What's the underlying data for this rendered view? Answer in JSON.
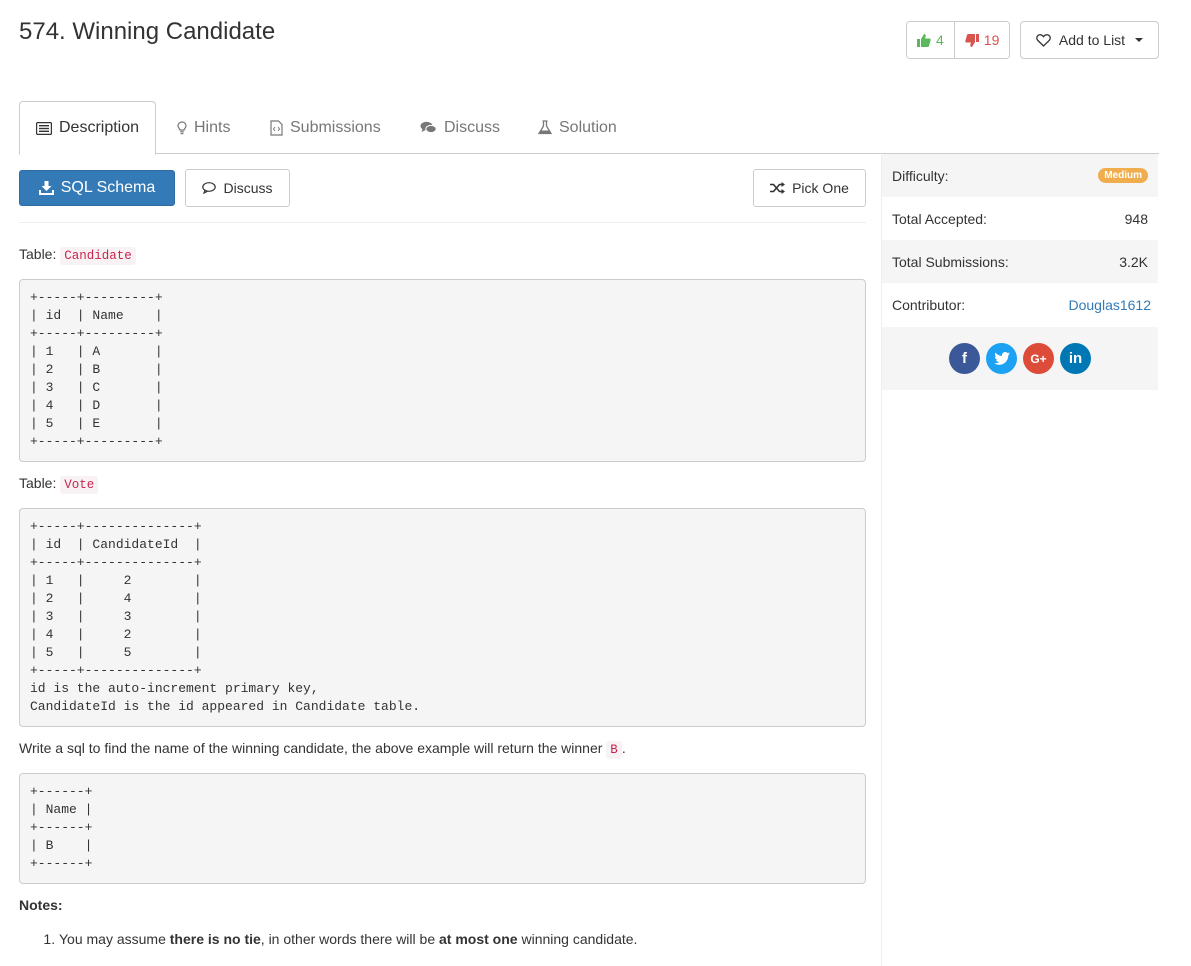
{
  "problem": {
    "title": "574. Winning Candidate"
  },
  "votes": {
    "up": "4",
    "down": "19"
  },
  "add_to_list": "Add to List",
  "tabs": [
    "Description",
    "Hints",
    "Submissions",
    "Discuss",
    "Solution"
  ],
  "toolbar": {
    "schema": "SQL Schema",
    "discuss": "Discuss",
    "pick_one": "Pick One"
  },
  "description": {
    "table_prefix": "Table:",
    "table1_name": "Candidate",
    "table1": "+-----+---------+\n| id  | Name    |\n+-----+---------+\n| 1   | A       |\n| 2   | B       |\n| 3   | C       |\n| 4   | D       |\n| 5   | E       |\n+-----+---------+",
    "table2_name": "Vote",
    "table2": "+-----+--------------+\n| id  | CandidateId  |\n+-----+--------------+\n| 1   |     2        |\n| 2   |     4        |\n| 3   |     3        |\n| 4   |     2        |\n| 5   |     5        |\n+-----+--------------+\nid is the auto-increment primary key,\nCandidateId is the id appeared in Candidate table.",
    "task_text": "Write a sql to find the name of the winning candidate, the above example will return the winner",
    "task_winner": "B",
    "task_end": ".",
    "result_table": "+------+\n| Name |\n+------+\n| B    |\n+------+",
    "notes_title": "Notes:",
    "note1": {
      "part1": "You may assume ",
      "bold1": "there is no tie",
      "part2": ", in other words there will be ",
      "bold2": "at most one",
      "part3": " winning candidate."
    }
  },
  "sidebar": {
    "difficulty_label": "Difficulty:",
    "difficulty_value": "Medium",
    "accepted_label": "Total Accepted:",
    "accepted_value": "948",
    "submissions_label": "Total Submissions:",
    "submissions_value": "3.2K",
    "contributor_label": "Contributor:",
    "contributor_value": "Douglas1612"
  },
  "social": {
    "facebook": "f",
    "google": "G+",
    "linkedin": "in"
  },
  "colors": {
    "primary": "#337ab7",
    "medium_badge": "#f0ad4e",
    "upvote": "#5cb85c",
    "downvote": "#d9534f",
    "facebook": "#3b5998",
    "twitter": "#1da1f2",
    "google": "#dd4b39",
    "linkedin": "#0077b5"
  }
}
